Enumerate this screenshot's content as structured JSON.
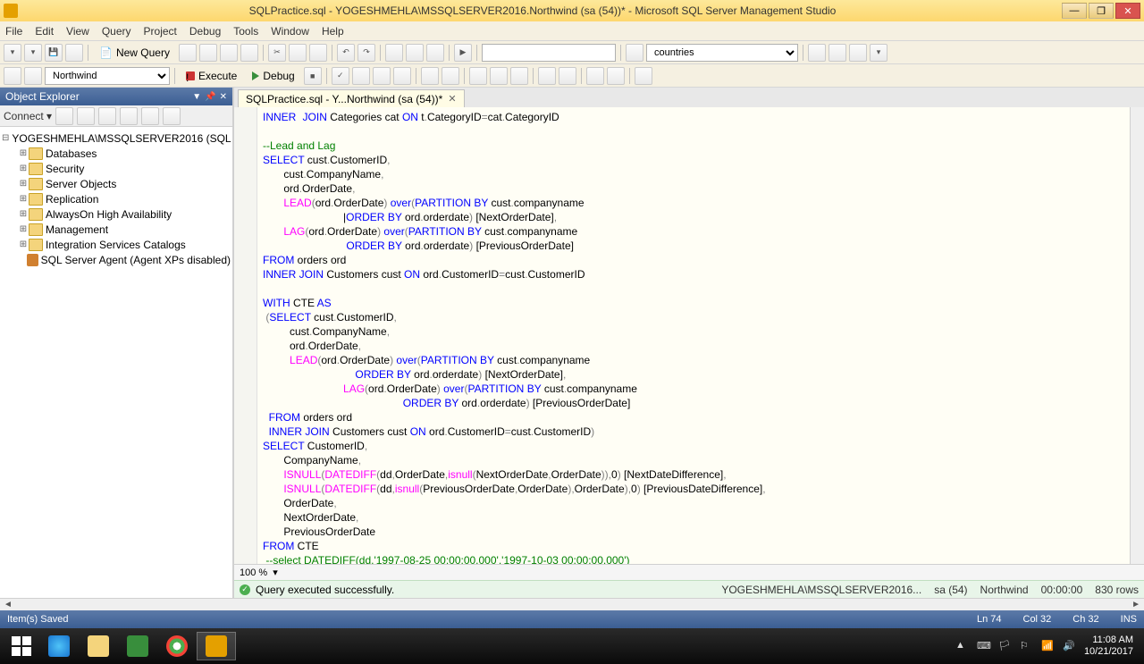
{
  "window": {
    "title": "SQLPractice.sql - YOGESHMEHLA\\MSSQLSERVER2016.Northwind (sa (54))* - Microsoft SQL Server Management Studio"
  },
  "menu": [
    "File",
    "Edit",
    "View",
    "Query",
    "Project",
    "Debug",
    "Tools",
    "Window",
    "Help"
  ],
  "toolbar1": {
    "new_query": "New Query",
    "find_combo": "",
    "right_combo": "countries"
  },
  "toolbar2": {
    "db_combo": "Northwind",
    "execute": "Execute",
    "debug": "Debug"
  },
  "object_explorer": {
    "title": "Object Explorer",
    "connect": "Connect",
    "server": "YOGESHMEHLA\\MSSQLSERVER2016 (SQL",
    "folders": [
      "Databases",
      "Security",
      "Server Objects",
      "Replication",
      "AlwaysOn High Availability",
      "Management",
      "Integration Services Catalogs"
    ],
    "agent": "SQL Server Agent (Agent XPs disabled)"
  },
  "tab": {
    "label": "SQLPractice.sql - Y...Northwind (sa (54))*"
  },
  "zoom": "100 %",
  "result": {
    "message": "Query executed successfully.",
    "server": "YOGESHMEHLA\\MSSQLSERVER2016...",
    "user": "sa (54)",
    "db": "Northwind",
    "time": "00:00:00",
    "rows": "830 rows"
  },
  "status": {
    "left": "Item(s) Saved",
    "line": "Ln 74",
    "col": "Col 32",
    "ch": "Ch 32",
    "ins": "INS"
  },
  "taskbar": {
    "time": "11:08 AM",
    "date": "10/21/2017"
  },
  "code": {
    "l1a": "INNER",
    "l1b": "JOIN",
    "l1c": " Categories cat ",
    "l1d": "ON",
    "l1e": " t",
    "l1f": ".",
    "l1g": "CategoryID",
    "l1h": "=",
    "l1i": "cat",
    "l1j": ".",
    "l1k": "CategoryID",
    "blank1": "",
    "l2": "--Lead and Lag",
    "l3a": "SELECT",
    "l3b": " cust",
    "l3c": ".",
    "l3d": "CustomerID",
    "l3e": ",",
    "l4a": "       cust",
    "l4b": ".",
    "l4c": "CompanyName",
    "l4d": ",",
    "l5a": "       ord",
    "l5b": ".",
    "l5c": "OrderDate",
    "l5d": ",",
    "l6a": "       ",
    "l6b": "LEAD",
    "l6c": "(",
    "l6d": "ord",
    "l6e": ".",
    "l6f": "OrderDate",
    "l6g": ")",
    "l6h": " over",
    "l6i": "(",
    "l6j": "PARTITION",
    "l6k": " BY",
    "l6l": " cust",
    "l6m": ".",
    "l6n": "companyname",
    "l7a": "                           |",
    "l7b": "ORDER",
    "l7c": " BY",
    "l7d": " ord",
    "l7e": ".",
    "l7f": "orderdate",
    "l7g": ")",
    "l7h": " [NextOrderDate]",
    "l7i": ",",
    "l8a": "       ",
    "l8b": "LAG",
    "l8c": "(",
    "l8d": "ord",
    "l8e": ".",
    "l8f": "OrderDate",
    "l8g": ")",
    "l8h": " over",
    "l8i": "(",
    "l8j": "PARTITION",
    "l8k": " BY",
    "l8l": " cust",
    "l8m": ".",
    "l8n": "companyname",
    "l9a": "                            ",
    "l9b": "ORDER",
    "l9c": " BY",
    "l9d": " ord",
    "l9e": ".",
    "l9f": "orderdate",
    "l9g": ")",
    "l9h": " [PreviousOrderDate]",
    "l10a": "FROM",
    "l10b": " orders ord",
    "l11a": "INNER",
    "l11b": " JOIN",
    "l11c": " Customers cust ",
    "l11d": "ON",
    "l11e": " ord",
    "l11f": ".",
    "l11g": "CustomerID",
    "l11h": "=",
    "l11i": "cust",
    "l11j": ".",
    "l11k": "CustomerID",
    "blank2": "",
    "l12a": "WITH",
    "l12b": " CTE ",
    "l12c": "AS",
    "l13a": " (",
    "l13b": "SELECT",
    "l13c": " cust",
    "l13d": ".",
    "l13e": "CustomerID",
    "l13f": ",",
    "l14a": "         cust",
    "l14b": ".",
    "l14c": "CompanyName",
    "l14d": ",",
    "l15a": "         ord",
    "l15b": ".",
    "l15c": "OrderDate",
    "l15d": ",",
    "l16a": "         ",
    "l16b": "LEAD",
    "l16c": "(",
    "l16d": "ord",
    "l16e": ".",
    "l16f": "OrderDate",
    "l16g": ")",
    "l16h": " over",
    "l16i": "(",
    "l16j": "PARTITION",
    "l16k": " BY",
    "l16l": " cust",
    "l16m": ".",
    "l16n": "companyname",
    "l17a": "                               ",
    "l17b": "ORDER",
    "l17c": " BY",
    "l17d": " ord",
    "l17e": ".",
    "l17f": "orderdate",
    "l17g": ")",
    "l17h": " [NextOrderDate]",
    "l17i": ",",
    "l18a": "                           ",
    "l18b": "LAG",
    "l18c": "(",
    "l18d": "ord",
    "l18e": ".",
    "l18f": "OrderDate",
    "l18g": ")",
    "l18h": " over",
    "l18i": "(",
    "l18j": "PARTITION",
    "l18k": " BY",
    "l18l": " cust",
    "l18m": ".",
    "l18n": "companyname",
    "l19a": "                                               ",
    "l19b": "ORDER",
    "l19c": " BY",
    "l19d": " ord",
    "l19e": ".",
    "l19f": "orderdate",
    "l19g": ")",
    "l19h": " [PreviousOrderDate]",
    "l20a": "  FROM",
    "l20b": " orders ord",
    "l21a": "  INNER",
    "l21b": " JOIN",
    "l21c": " Customers cust ",
    "l21d": "ON",
    "l21e": " ord",
    "l21f": ".",
    "l21g": "CustomerID",
    "l21h": "=",
    "l21i": "cust",
    "l21j": ".",
    "l21k": "CustomerID",
    "l21l": ")",
    "l22a": "SELECT",
    "l22b": " CustomerID",
    "l22c": ",",
    "l23a": "       CompanyName",
    "l23b": ",",
    "l24a": "       ",
    "l24b": "ISNULL",
    "l24c": "(",
    "l24d": "DATEDIFF",
    "l24e": "(",
    "l24f": "dd",
    "l24g": ",",
    "l24h": "OrderDate",
    "l24i": ",",
    "l24j": "isnull",
    "l24k": "(",
    "l24l": "NextOrderDate",
    "l24m": ",",
    "l24n": "OrderDate",
    "l24o": "))",
    "l24p": ",",
    "l24q": "0",
    "l24r": ")",
    "l24s": " [NextDateDifference]",
    "l24t": ",",
    "l25a": "       ",
    "l25b": "ISNULL",
    "l25c": "(",
    "l25d": "DATEDIFF",
    "l25e": "(",
    "l25f": "dd",
    "l25g": ",",
    "l25h": "isnull",
    "l25i": "(",
    "l25j": "PreviousOrderDate",
    "l25k": ",",
    "l25l": "OrderDate",
    "l25m": ")",
    "l25n": ",",
    "l25o": "OrderDate",
    "l25p": ")",
    "l25q": ",",
    "l25r": "0",
    "l25s": ")",
    "l25t": " [PreviousDateDifference]",
    "l25u": ",",
    "l26a": "       OrderDate",
    "l26b": ",",
    "l27a": "       NextOrderDate",
    "l27b": ",",
    "l28a": "       PreviousOrderDate",
    "l29a": "FROM",
    "l29b": " CTE",
    "l30a": " --select DATEDIFF(dd,'1997-08-25 00:00:00.000','1997-10-03 00:00:00.000')"
  }
}
